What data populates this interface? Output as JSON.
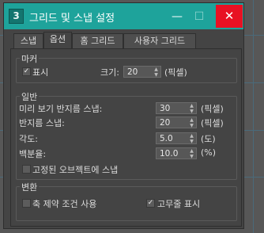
{
  "window": {
    "title": "그리드 및 스냅 설정",
    "app_icon_glyph": "3"
  },
  "tabs": [
    {
      "label": "스냅"
    },
    {
      "label": "옵션"
    },
    {
      "label": "홈 그리드"
    },
    {
      "label": "사용자 그리드"
    }
  ],
  "active_tab": "옵션",
  "marker": {
    "group_label": "마커",
    "show_label": "표시",
    "show_checked": true,
    "size_label": "크기:",
    "size_value": "20",
    "size_unit": "(픽셀)"
  },
  "general": {
    "group_label": "일반",
    "preview_radius_label": "미리 보기 반지름 스냅:",
    "preview_radius_value": "30",
    "preview_radius_unit": "(픽셀)",
    "snap_radius_label": "반지름 스냅:",
    "snap_radius_value": "20",
    "snap_radius_unit": "(픽셀)",
    "angle_label": "각도:",
    "angle_value": "5.0",
    "angle_unit": "(도)",
    "percent_label": "백분율:",
    "percent_value": "10.0",
    "percent_unit": "(%)",
    "snap_frozen_label": "고정된 오브젝트에 스냅",
    "snap_frozen_checked": false
  },
  "translation": {
    "group_label": "변환",
    "axis_constraint_label": "축 제약 조건 사용",
    "axis_constraint_checked": false,
    "rubber_band_label": "고무줄 표시",
    "rubber_band_checked": true
  },
  "colors": {
    "titlebar": "#1ea39b",
    "close_button": "#e81123",
    "panel_bg": "#444444"
  }
}
